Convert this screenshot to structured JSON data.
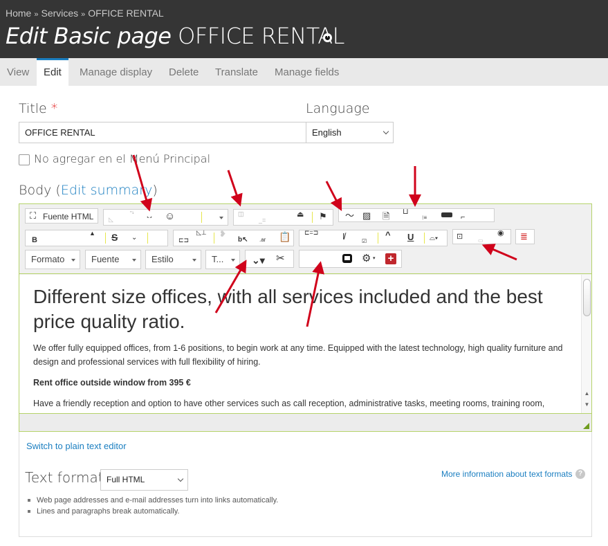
{
  "header": {
    "breadcrumb": [
      "Home",
      "Services",
      "OFFICE RENTAL"
    ],
    "breadcrumb_separator": "»",
    "title_italic": "Edit Basic page",
    "title_plain": "OFFICE RENTAL"
  },
  "tabs": [
    {
      "label": "View",
      "active": false
    },
    {
      "label": "Edit",
      "active": true
    },
    {
      "label": "Manage display",
      "active": false
    },
    {
      "label": "Delete",
      "active": false
    },
    {
      "label": "Translate",
      "active": false
    },
    {
      "label": "Manage fields",
      "active": false
    }
  ],
  "form": {
    "title_label": "Title",
    "required_marker": "*",
    "title_value": "OFFICE RENTAL",
    "language_label": "Language",
    "language_value": "English",
    "menu_checkbox_label": "No agregar en el Menú Principal",
    "menu_checkbox_checked": false,
    "body_label": "Body (",
    "body_label_close": ")",
    "edit_summary_link": "Edit summary"
  },
  "toolbar": {
    "source_button": "Fuente HTML",
    "format_combo": "Formato",
    "font_combo": "Fuente",
    "style_combo": "Estilo",
    "size_combo": "T...",
    "icons": [
      "maximize-icon",
      "smiley-icon",
      "flag-icon",
      "link-icon",
      "image-icon",
      "document-icon",
      "table-icon",
      "horizontal-rule-icon",
      "strikethrough-icon",
      "paste-icon",
      "remove-format-icon",
      "superscript-icon",
      "underline-icon",
      "show-blocks-icon",
      "gear-icon",
      "add-icon",
      "scissors-icon"
    ]
  },
  "editor_content": {
    "heading": "Different size offices, with all services included and the best price quality ratio.",
    "paragraph1": "We offer fully equipped offices, from 1-6 positions, to begin work at any time. Equipped with the latest technology, high quality furniture and design and professional services with full flexibility of hiring.",
    "paragraph2_bold": "Rent office outside window from 395 €",
    "paragraph3": "Have a friendly reception and option to have other services such as call reception, administrative tasks, meeting rooms, training room,"
  },
  "below_editor": {
    "switch_link": "Switch to plain text editor",
    "text_format_label": "Text format",
    "text_format_value": "Full HTML",
    "more_info_link": "More information about text formats",
    "help_glyph": "?",
    "tips": [
      "Web page addresses and e-mail addresses turn into links automatically.",
      "Lines and paragraphs break automatically."
    ]
  },
  "colors": {
    "header_bg": "#353535",
    "accent_link": "#1a7ec0",
    "editor_border": "#b5d36a",
    "annotation_arrow": "#d0021b"
  }
}
